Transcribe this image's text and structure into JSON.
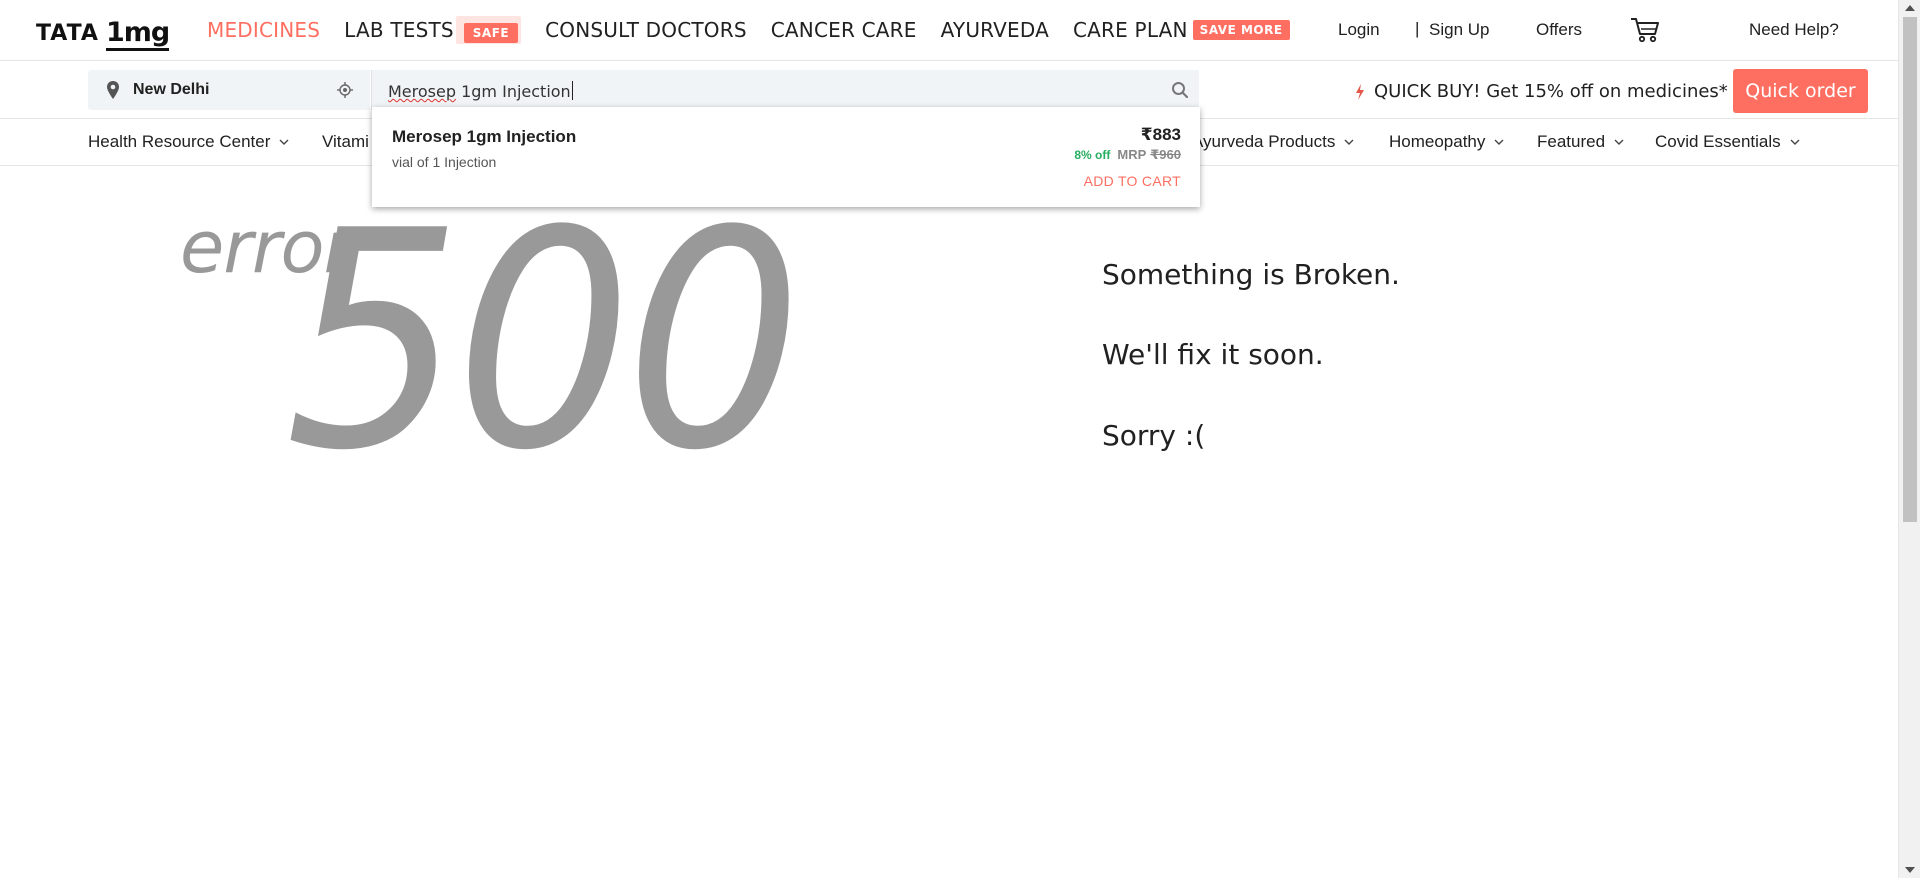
{
  "header": {
    "logo": {
      "brand": "TATA",
      "product": "1mg"
    },
    "nav": [
      {
        "label": "MEDICINES",
        "active": true
      },
      {
        "label": "LAB TESTS",
        "badge": "SAFE"
      },
      {
        "label": "CONSULT DOCTORS"
      },
      {
        "label": "CANCER CARE"
      },
      {
        "label": "AYURVEDA"
      },
      {
        "label": "CARE PLAN",
        "badge": "SAVE MORE"
      }
    ],
    "login": "Login",
    "separator": "|",
    "signup": "Sign Up",
    "offers": "Offers",
    "help": "Need Help?"
  },
  "search": {
    "location": "New Delhi",
    "query_word1": "Merosep",
    "query_rest": " 1gm Injection",
    "quick_buy_text": "QUICK BUY! Get 15% off on medicines*",
    "quick_order_button": "Quick order"
  },
  "categories": [
    "Health Resource Center",
    "Vitami",
    "Ayurveda Products",
    "Homeopathy",
    "Featured",
    "Covid Essentials"
  ],
  "suggestion": {
    "name": "Merosep 1gm Injection",
    "pack": "vial of 1 Injection",
    "price": "₹883",
    "discount": "8% off",
    "mrp_label": "MRP",
    "mrp_value": "₹960",
    "add_to_cart": "ADD TO CART"
  },
  "error": {
    "word": "error",
    "code": "500",
    "messages": [
      "Something is Broken.",
      "We'll fix it soon.",
      "Sorry :("
    ]
  },
  "colors": {
    "accent": "#ff6f61",
    "discount_green": "#27ae60",
    "error_gray": "#999999"
  },
  "icons": [
    "location-pin-icon",
    "gps-target-icon",
    "search-icon",
    "lightning-bolt-icon",
    "cart-icon",
    "chevron-down-icon"
  ]
}
